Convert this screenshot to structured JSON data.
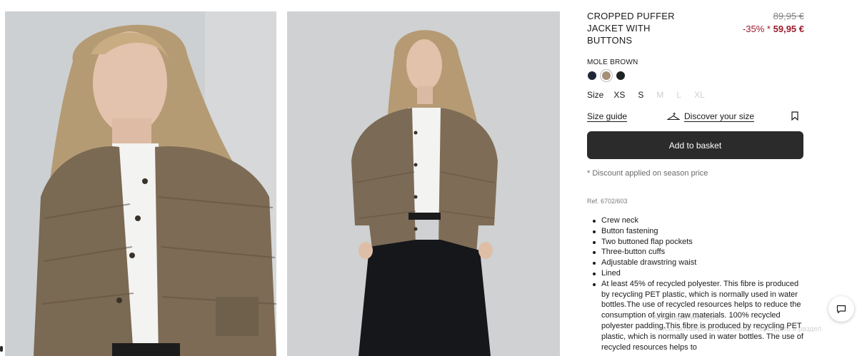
{
  "product": {
    "title": "CROPPED PUFFER JACKET WITH BUTTONS",
    "price_original": "89,95 €",
    "discount": "-35% *",
    "price_sale": "59,95 €"
  },
  "colour": {
    "name": "MOLE BROWN",
    "swatches": [
      {
        "icon": "swatch-navy",
        "color": "#1f2638"
      },
      {
        "icon": "swatch-mole-brown",
        "color": "#a68f78",
        "selected": true
      },
      {
        "icon": "swatch-dark",
        "color": "#1d2422"
      }
    ]
  },
  "sizes": {
    "label": "Size",
    "options": [
      {
        "label": "XS",
        "available": true
      },
      {
        "label": "S",
        "available": true
      },
      {
        "label": "M",
        "available": false
      },
      {
        "label": "L",
        "available": false
      },
      {
        "label": "XL",
        "available": false
      }
    ]
  },
  "links": {
    "size_guide": "Size guide",
    "discover_size": "Discover your size"
  },
  "actions": {
    "add_to_basket": "Add to basket"
  },
  "notes": {
    "discount": "* Discount applied on season price",
    "ref": "Ref. 6702/603"
  },
  "features": [
    "Crew neck",
    "Button fastening",
    "Two buttoned flap pockets",
    "Three-button cuffs",
    "Adjustable drawstring waist",
    "Lined",
    "At least 45% of recycled polyester. This fibre is produced by recycling PET plastic, which is normally used in water bottles.The use of recycled resources helps to reduce the consumption of virgin raw materials. 100% recycled polyester padding.This fibre is produced by recycling PET plastic, which is normally used in water bottles. The use of recycled resources helps to"
  ],
  "overlay": {
    "line1": "Активация Windows",
    "line2": "Чтобы активировать Windows, перейдите в раздел"
  },
  "colors": {
    "accent_sale": "#9b1b2c",
    "button_bg": "#2b2b2b",
    "jacket": "#7b6a55",
    "background_photo": "#cfd0d0"
  }
}
